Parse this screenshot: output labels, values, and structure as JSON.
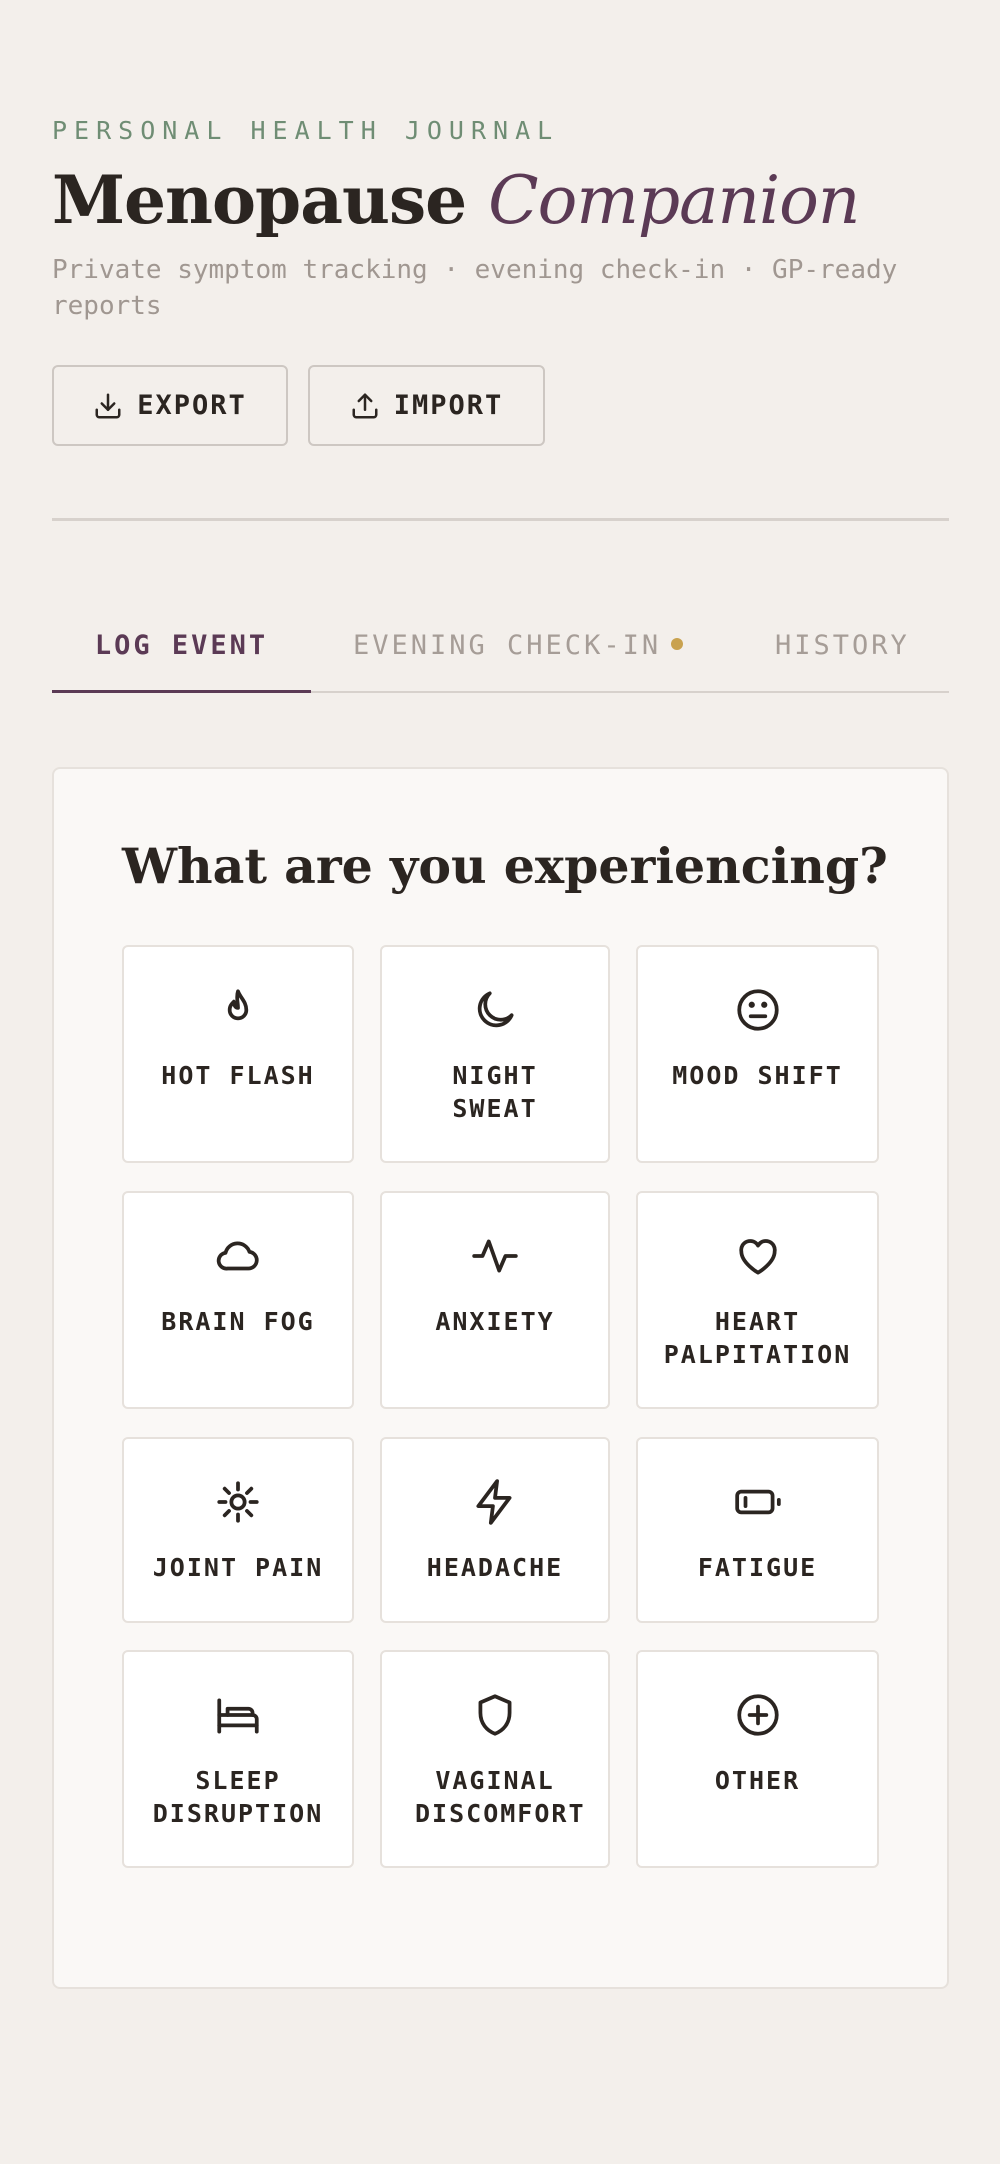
{
  "header": {
    "eyebrow": "PERSONAL HEALTH JOURNAL",
    "title_main": "Menopause",
    "title_accent": "Companion",
    "subtitle": "Private symptom tracking · evening check-in · GP-ready reports"
  },
  "actions": {
    "export_label": "EXPORT",
    "import_label": "IMPORT"
  },
  "tabs": [
    {
      "label": "LOG EVENT",
      "active": true
    },
    {
      "label": "EVENING CHECK-IN",
      "badge": "dot"
    },
    {
      "label": "HISTORY"
    }
  ],
  "panel": {
    "title": "What are you experiencing?",
    "symptoms": [
      {
        "label": "HOT FLASH",
        "icon": "flame-icon"
      },
      {
        "label": "NIGHT SWEAT",
        "icon": "moon-icon"
      },
      {
        "label": "MOOD SHIFT",
        "icon": "neutral-face-icon"
      },
      {
        "label": "BRAIN FOG",
        "icon": "cloud-icon"
      },
      {
        "label": "ANXIETY",
        "icon": "activity-icon"
      },
      {
        "label": "HEART PALPITATION",
        "icon": "heart-icon"
      },
      {
        "label": "JOINT PAIN",
        "icon": "sun-icon"
      },
      {
        "label": "HEADACHE",
        "icon": "lightning-icon"
      },
      {
        "label": "FATIGUE",
        "icon": "battery-low-icon"
      },
      {
        "label": "SLEEP DISRUPTION",
        "icon": "bed-icon"
      },
      {
        "label": "VAGINAL DISCOMFORT",
        "icon": "shield-icon"
      },
      {
        "label": "OTHER",
        "icon": "plus-circle-icon"
      }
    ]
  },
  "colors": {
    "background": "#f3efeb",
    "accent": "#5b3a55",
    "eyebrow": "#6f8d74",
    "badge": "#c9a24f"
  }
}
